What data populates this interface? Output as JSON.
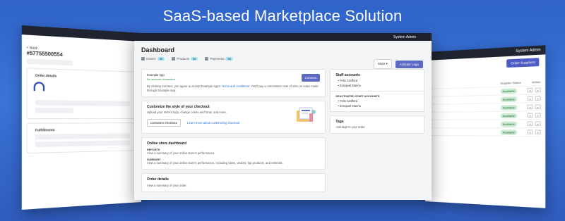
{
  "headline": "SaaS-based Marketplace Solution",
  "colors": {
    "background": "#3068cc",
    "primary": "#5c6ac4",
    "topbar": "#1c212d",
    "badge": "#a4e8f2"
  },
  "main": {
    "topbar_user": "System Admin",
    "title": "Dashboard",
    "stats": [
      {
        "label": "Orders",
        "count": "58",
        "icon": "orders-icon"
      },
      {
        "label": "Products",
        "count": "58",
        "icon": "products-icon"
      },
      {
        "label": "Payments",
        "count": "58",
        "icon": "payments-icon"
      }
    ],
    "more_label": "More",
    "activate_label": "Activate Logo",
    "example_app": {
      "title": "Example App",
      "status": "No account connected",
      "connect_label": "Connect",
      "text_before": "By clicking Connect, you agree to accept Example App's",
      "terms_link": "Terms and conditions",
      "text_after": ". You'll pay a commission rate of 15% on sales made through Example App."
    },
    "customize": {
      "title": "Customize the style of your checkout",
      "desc": "Upload your store's logo, change colors and fonts, and more.",
      "button": "Customize checkout",
      "link": "Learn more about customizing checkout"
    },
    "online_store": {
      "title": "Online store dashboard",
      "reports_heading": "REPORTS",
      "reports_text": "View a summary of your online store's performance.",
      "summary_heading": "SUMMARY",
      "summary_text": "View a summary of your online store's performance, including sales, visitors, top products, and referrals."
    },
    "order_details": {
      "title": "Order details",
      "text": "View a summary of your order."
    },
    "staff": {
      "title": "Staff accounts",
      "accounts": [
        "Felix Crafford",
        "Ezequiel Manno"
      ],
      "deactivated_heading": "DEACTIVATED STAFF ACCOUNTS",
      "deactivated": [
        "Felix Crafford",
        "Ezequiel Manno"
      ]
    },
    "tags": {
      "title": "Tags",
      "text": "Add tags to your order."
    }
  },
  "left_panel": {
    "back": "< Back",
    "order_no": "#57755500554",
    "order_details": "Order details",
    "fulfillments": "Fulfillments"
  },
  "right_panel": {
    "topbar_user": "System Admin",
    "button": "Order Suppliers",
    "column_status": "Supplier Status",
    "column_action": "Action",
    "status": "Available"
  }
}
